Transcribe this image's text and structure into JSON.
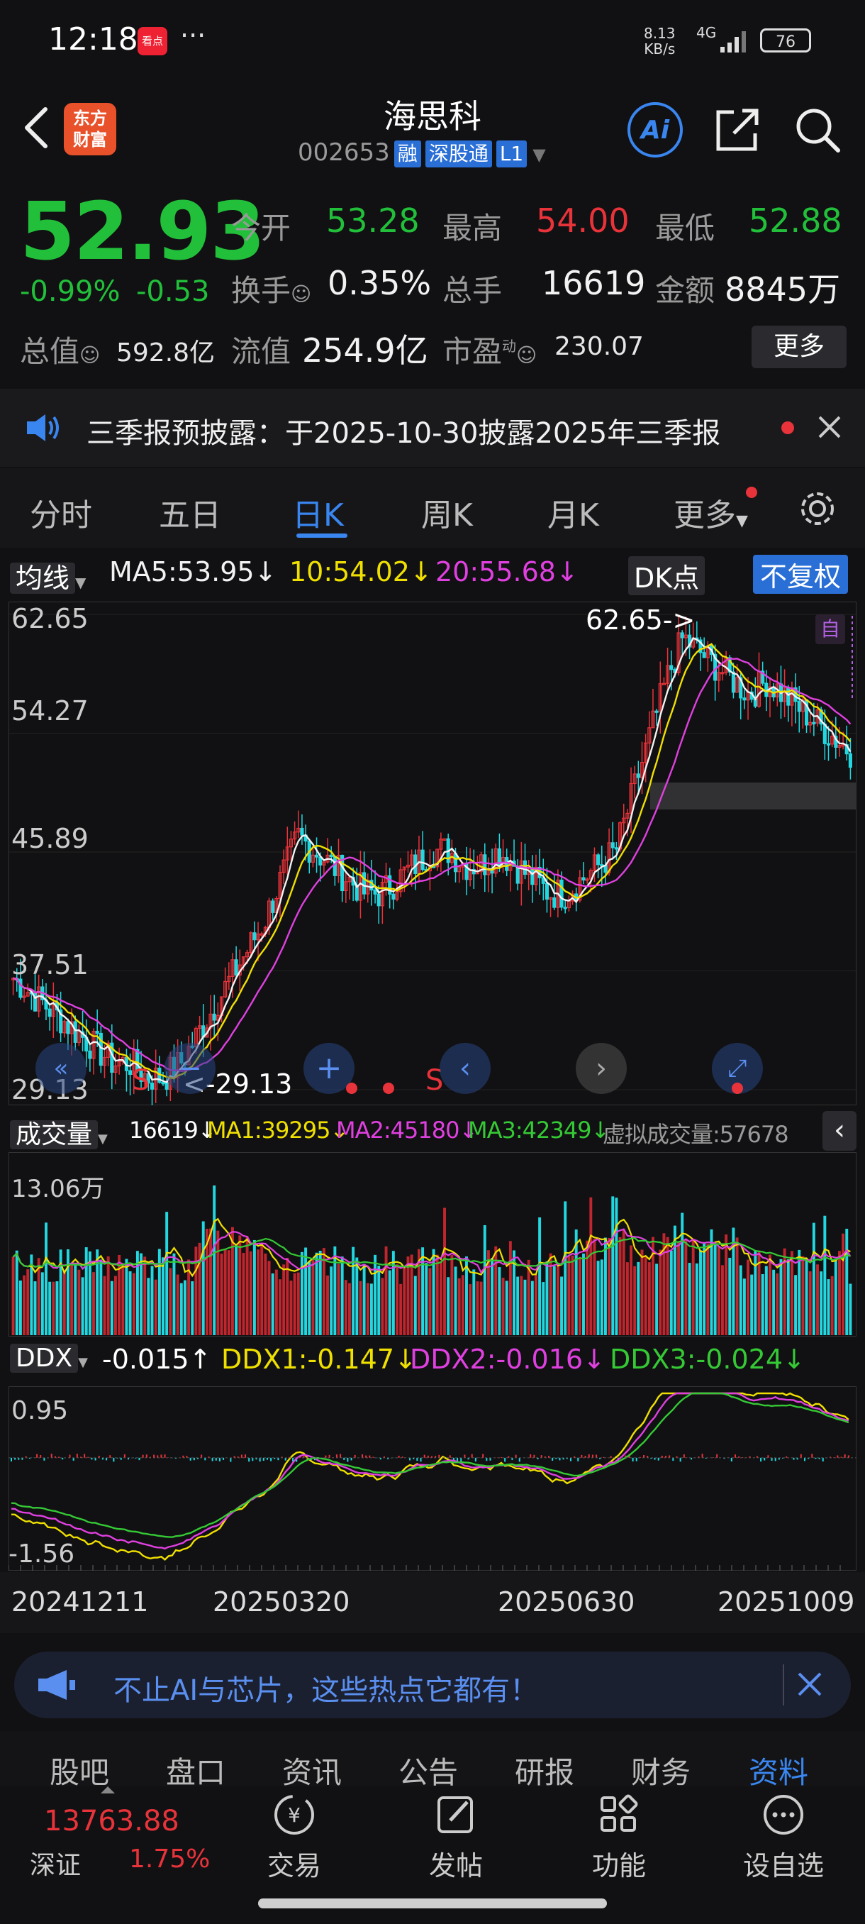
{
  "status_bar": {
    "time": "12:18",
    "app_badge": "看点",
    "more_dots": "···",
    "net_speed": "8.13",
    "net_speed_unit": "KB/s",
    "network": "4G",
    "battery": "76"
  },
  "header": {
    "logo_line1": "东方",
    "logo_line2": "财富",
    "stock_name": "海思科",
    "stock_code": "002653",
    "tags": [
      "融",
      "深股通",
      "L1"
    ]
  },
  "quote": {
    "price": "52.93",
    "change_pct": "-0.99%",
    "change": "-0.53",
    "open_label": "今开",
    "open": "53.28",
    "high_label": "最高",
    "high": "54.00",
    "low_label": "最低",
    "low": "52.88",
    "turnover_label": "换手",
    "turnover": "0.35%",
    "volume_label": "总手",
    "volume": "16619",
    "amount_label": "金额",
    "amount": "8845万",
    "mktcap_label": "总值",
    "mktcap": "592.8亿",
    "float_label": "流值",
    "float_cap": "254.9亿",
    "pe_label": "市盈",
    "pe_sup": "动",
    "pe": "230.07",
    "more": "更多"
  },
  "notice": {
    "text": "三季报预披露：于2025-10-30披露2025年三季报"
  },
  "tabs": [
    "分时",
    "五日",
    "日K",
    "周K",
    "月K",
    "更多"
  ],
  "active_tab": "日K",
  "ma_row": {
    "selector": "均线",
    "ma5": "MA5:53.95↓",
    "ma10": "10:54.02↓",
    "ma20": "20:55.68↓",
    "dk": "DK点",
    "adjust": "不复权"
  },
  "kline": {
    "y_labels": [
      "62.65",
      "54.27",
      "45.89",
      "37.51",
      "29.13"
    ],
    "high_marker": "62.65->",
    "low_marker": "<-29.13",
    "self_tag": "自",
    "s_marks": [
      "S",
      "S"
    ]
  },
  "volume_row": {
    "selector": "成交量",
    "value": "16619↓",
    "ma1": "MA1:39295↓",
    "ma2": "MA2:45180↓",
    "ma3": "MA3:42349↓",
    "virtual": "虚拟成交量:57678",
    "max_label": "13.06万"
  },
  "ddx_row": {
    "selector": "DDX",
    "value": "-0.015↑",
    "ddx1": "DDX1:-0.147↓",
    "ddx2": "DDX2:-0.016↓",
    "ddx3": "DDX3:-0.024↓",
    "y_top": "0.95",
    "y_bottom": "-1.56"
  },
  "x_dates": [
    "20241211",
    "20250320",
    "20250630",
    "20251009"
  ],
  "banner": {
    "text": "不止AI与芯片，这些热点它都有！"
  },
  "sub_tabs": [
    "股吧",
    "盘口",
    "资讯",
    "公告",
    "研报",
    "财务",
    "资料"
  ],
  "active_sub_tab": "资料",
  "bottom_bar": {
    "index_value": "13763.88",
    "index_name": "深证",
    "index_change": "1.75%",
    "items": [
      "交易",
      "发帖",
      "功能",
      "设自选"
    ]
  },
  "colors": {
    "up": "#e8333a",
    "down": "#22c03a",
    "accent": "#3a86f0",
    "ma5": "#f2f2f2",
    "ma10": "#f0e000",
    "ma20": "#e040e0",
    "volume_down": "#22d8e0"
  },
  "chart_data": [
    {
      "type": "candlestick",
      "title": "日K",
      "x_range": [
        "20241211",
        "20251009"
      ],
      "ylim": [
        29.13,
        62.65
      ],
      "y_ticks": [
        62.65,
        54.27,
        45.89,
        37.51,
        29.13
      ],
      "annotations": [
        "62.65->",
        "<-29.13"
      ],
      "series": [
        {
          "name": "MA5",
          "latest": 53.95
        },
        {
          "name": "MA10",
          "latest": 54.02
        },
        {
          "name": "MA20",
          "latest": 55.68
        }
      ],
      "approx_close": [
        37,
        36,
        35,
        34,
        33,
        32,
        31,
        31,
        30,
        30,
        31,
        33,
        35,
        37,
        39,
        41,
        44,
        47,
        46,
        45,
        44,
        43,
        43,
        44,
        45,
        46,
        46,
        45,
        45,
        46,
        45,
        44,
        43,
        43,
        44,
        45,
        46,
        50,
        54,
        58,
        61,
        60,
        59,
        58,
        57,
        58,
        57,
        56,
        55,
        54,
        53
      ]
    },
    {
      "type": "bar",
      "title": "成交量",
      "ymax": "13.06万",
      "series": [
        {
          "name": "MA1",
          "latest": 39295
        },
        {
          "name": "MA2",
          "latest": 45180
        },
        {
          "name": "MA3",
          "latest": 42349
        }
      ]
    },
    {
      "type": "line",
      "title": "DDX",
      "ylim": [
        -1.56,
        0.95
      ],
      "series": [
        {
          "name": "DDX1",
          "latest": -0.147
        },
        {
          "name": "DDX2",
          "latest": -0.016
        },
        {
          "name": "DDX3",
          "latest": -0.024
        }
      ]
    }
  ]
}
